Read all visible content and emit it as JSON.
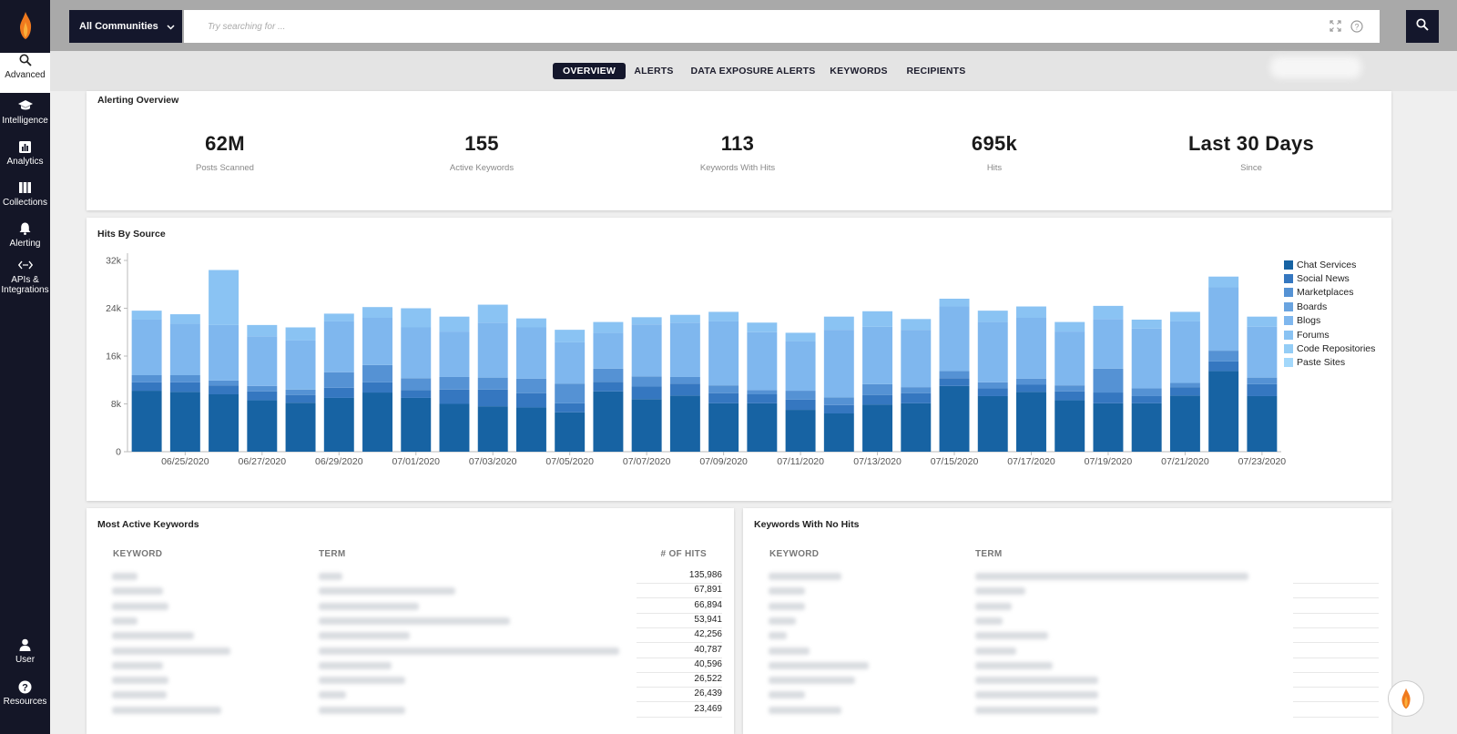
{
  "sidebar": {
    "items": [
      {
        "label": "Advanced",
        "icon": "search-icon"
      },
      {
        "label": "Intelligence",
        "icon": "graduation-cap-icon"
      },
      {
        "label": "Analytics",
        "icon": "bar-chart-icon"
      },
      {
        "label": "Collections",
        "icon": "columns-icon"
      },
      {
        "label": "Alerting",
        "icon": "bell-icon"
      },
      {
        "label": "APIs & Integrations",
        "icon": "code-icon"
      }
    ],
    "bottom": [
      {
        "label": "User",
        "icon": "user-icon"
      },
      {
        "label": "Resources",
        "icon": "help-icon"
      }
    ]
  },
  "topbar": {
    "community": "All Communities",
    "search_placeholder": "Try searching for ..."
  },
  "tabs": [
    "OVERVIEW",
    "ALERTS",
    "DATA EXPOSURE ALERTS",
    "KEYWORDS",
    "RECIPIENTS"
  ],
  "overview": {
    "title": "Alerting Overview",
    "stats": [
      {
        "value": "62M",
        "label": "Posts Scanned"
      },
      {
        "value": "155",
        "label": "Active Keywords"
      },
      {
        "value": "113",
        "label": "Keywords With Hits"
      },
      {
        "value": "695k",
        "label": "Hits"
      },
      {
        "value": "Last 30 Days",
        "label": "Since"
      }
    ]
  },
  "hits_title": "Hits By Source",
  "colors": {
    "series": [
      "#1763a3",
      "#3577c0",
      "#5592d4",
      "#6aa4e0",
      "#7fb7ee",
      "#8ac3f3",
      "#94cdf6",
      "#a3d8fb"
    ]
  },
  "chart_data": {
    "type": "bar",
    "stacked": true,
    "title": "Hits By Source",
    "xlabel": "",
    "ylabel": "",
    "ylim": [
      0,
      32000
    ],
    "yticks": [
      "0",
      "8k",
      "16k",
      "24k",
      "32k"
    ],
    "xtick_labels": [
      "06/25/2020",
      "06/27/2020",
      "06/29/2020",
      "07/01/2020",
      "07/03/2020",
      "07/05/2020",
      "07/07/2020",
      "07/09/2020",
      "07/11/2020",
      "07/13/2020",
      "07/15/2020",
      "07/17/2020",
      "07/19/2020",
      "07/21/2020",
      "07/23/2020"
    ],
    "legend_position": "right",
    "categories": [
      "06/24/2020",
      "06/25/2020",
      "06/26/2020",
      "06/27/2020",
      "06/28/2020",
      "06/29/2020",
      "06/30/2020",
      "07/01/2020",
      "07/02/2020",
      "07/03/2020",
      "07/04/2020",
      "07/05/2020",
      "07/06/2020",
      "07/07/2020",
      "07/08/2020",
      "07/09/2020",
      "07/10/2020",
      "07/11/2020",
      "07/12/2020",
      "07/13/2020",
      "07/14/2020",
      "07/15/2020",
      "07/16/2020",
      "07/17/2020",
      "07/18/2020",
      "07/19/2020",
      "07/20/2020",
      "07/21/2020",
      "07/22/2020",
      "07/23/2020"
    ],
    "series": [
      {
        "name": "Chat Services",
        "values": [
          10200,
          10000,
          9600,
          8600,
          8200,
          9000,
          9900,
          9000,
          8000,
          7600,
          7400,
          6600,
          10100,
          8800,
          9400,
          8100,
          8100,
          7000,
          6400,
          7900,
          8100,
          11000,
          9300,
          10000,
          8600,
          8100,
          8100,
          9400,
          13500,
          9300
        ]
      },
      {
        "name": "Social News",
        "values": [
          1400,
          1600,
          1500,
          1500,
          1300,
          1700,
          1700,
          1300,
          2400,
          2800,
          2400,
          1500,
          1600,
          2100,
          2000,
          1700,
          1500,
          1700,
          1400,
          1600,
          1700,
          1300,
          1300,
          1200,
          1500,
          1800,
          1200,
          1400,
          1600,
          2000
        ]
      },
      {
        "name": "Marketplaces",
        "values": [
          1200,
          1200,
          800,
          900,
          900,
          2600,
          2900,
          2000,
          2100,
          2000,
          2400,
          3300,
          2200,
          1700,
          1100,
          1300,
          700,
          1500,
          1300,
          1800,
          1000,
          1200,
          1000,
          1000,
          1000,
          4000,
          1300,
          700,
          1800,
          1100
        ]
      },
      {
        "name": "Boards",
        "values": [
          0,
          0,
          0,
          0,
          0,
          0,
          0,
          0,
          0,
          0,
          0,
          0,
          0,
          0,
          0,
          0,
          0,
          0,
          0,
          0,
          0,
          0,
          0,
          0,
          0,
          0,
          0,
          0,
          0,
          0
        ]
      },
      {
        "name": "Blogs",
        "values": [
          9300,
          8600,
          9300,
          8300,
          8200,
          8500,
          7900,
          8500,
          7600,
          9200,
          8600,
          6900,
          6000,
          8700,
          9100,
          10700,
          9700,
          8300,
          11300,
          9600,
          9600,
          10800,
          10100,
          10200,
          9000,
          8300,
          10000,
          10300,
          10600,
          8500
        ]
      },
      {
        "name": "Forums",
        "values": [
          1500,
          1600,
          9200,
          1900,
          2200,
          1300,
          1800,
          3200,
          2500,
          3000,
          1500,
          2100,
          1800,
          1200,
          1300,
          1600,
          1600,
          1400,
          2200,
          2600,
          1800,
          1300,
          1900,
          1900,
          1600,
          2200,
          1500,
          1600,
          1800,
          1700
        ]
      },
      {
        "name": "Code Repositories",
        "values": [
          0,
          0,
          0,
          0,
          0,
          0,
          0,
          0,
          0,
          0,
          0,
          0,
          0,
          0,
          0,
          0,
          0,
          0,
          0,
          0,
          0,
          0,
          0,
          0,
          0,
          0,
          0,
          0,
          0,
          0
        ]
      },
      {
        "name": "Paste Sites",
        "values": [
          0,
          0,
          0,
          0,
          0,
          0,
          0,
          0,
          0,
          0,
          0,
          0,
          0,
          0,
          0,
          0,
          0,
          0,
          0,
          0,
          0,
          0,
          0,
          0,
          0,
          0,
          0,
          0,
          0,
          0
        ]
      }
    ]
  },
  "most_active": {
    "title": "Most Active Keywords",
    "headers": [
      "KEYWORD",
      "TERM",
      "# OF HITS"
    ],
    "hits": [
      "135,986",
      "67,891",
      "66,894",
      "53,941",
      "42,256",
      "40,787",
      "40,596",
      "26,522",
      "26,439",
      "23,469"
    ]
  },
  "no_hits": {
    "title": "Keywords With No Hits",
    "headers": [
      "KEYWORD",
      "TERM"
    ]
  }
}
